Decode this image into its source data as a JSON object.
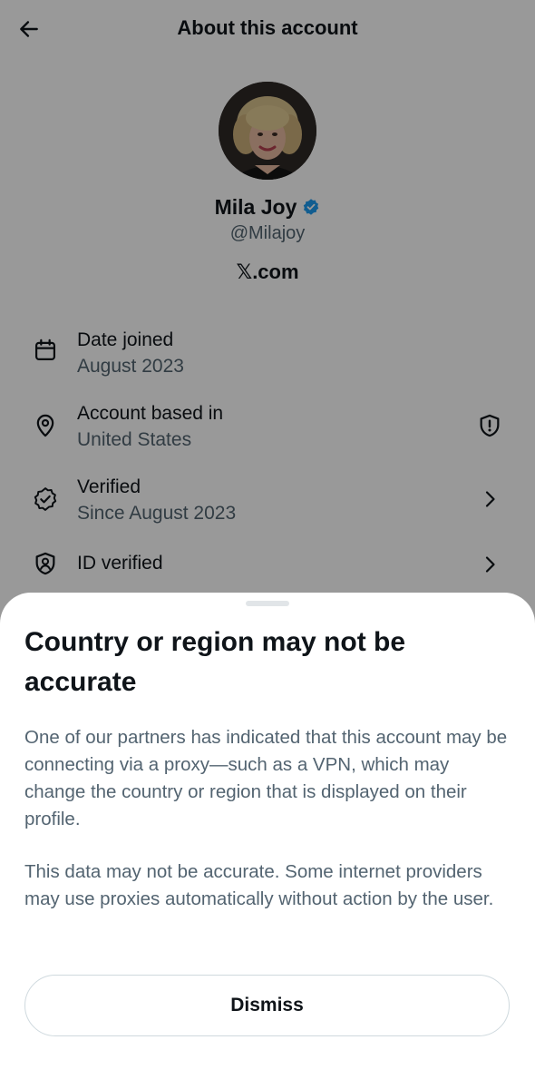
{
  "header": {
    "title": "About this account",
    "back_icon": "arrow-left-icon"
  },
  "profile": {
    "name": "Mila Joy",
    "handle": "@Milajoy",
    "website_logo": "𝕏",
    "website_suffix": ".com",
    "verified_color": "#1d9bf0"
  },
  "info": [
    {
      "icon": "calendar-icon",
      "label": "Date joined",
      "value": "August 2023"
    },
    {
      "icon": "location-pin-icon",
      "label": "Account based in",
      "value": "United States",
      "trailing_icon": "shield-alert-icon"
    },
    {
      "icon": "verified-badge-outline-icon",
      "label": "Verified",
      "value": "Since August 2023",
      "trailing_icon": "chevron-right-icon"
    },
    {
      "icon": "id-shield-icon",
      "label": "ID verified",
      "trailing_icon": "chevron-right-icon"
    }
  ],
  "sheet": {
    "title": "Country or region may not be accurate",
    "paragraph1": "One of our partners has indicated that this account may be connecting via a proxy—such as a VPN, which may change the country or region that is displayed on their profile.",
    "paragraph2": "This data may not be accurate. Some internet providers may use proxies automatically without action by the user.",
    "dismiss_label": "Dismiss"
  },
  "colors": {
    "text_primary": "#0f1419",
    "text_secondary": "#536471",
    "overlay": "rgba(0,0,0,0.40)"
  }
}
